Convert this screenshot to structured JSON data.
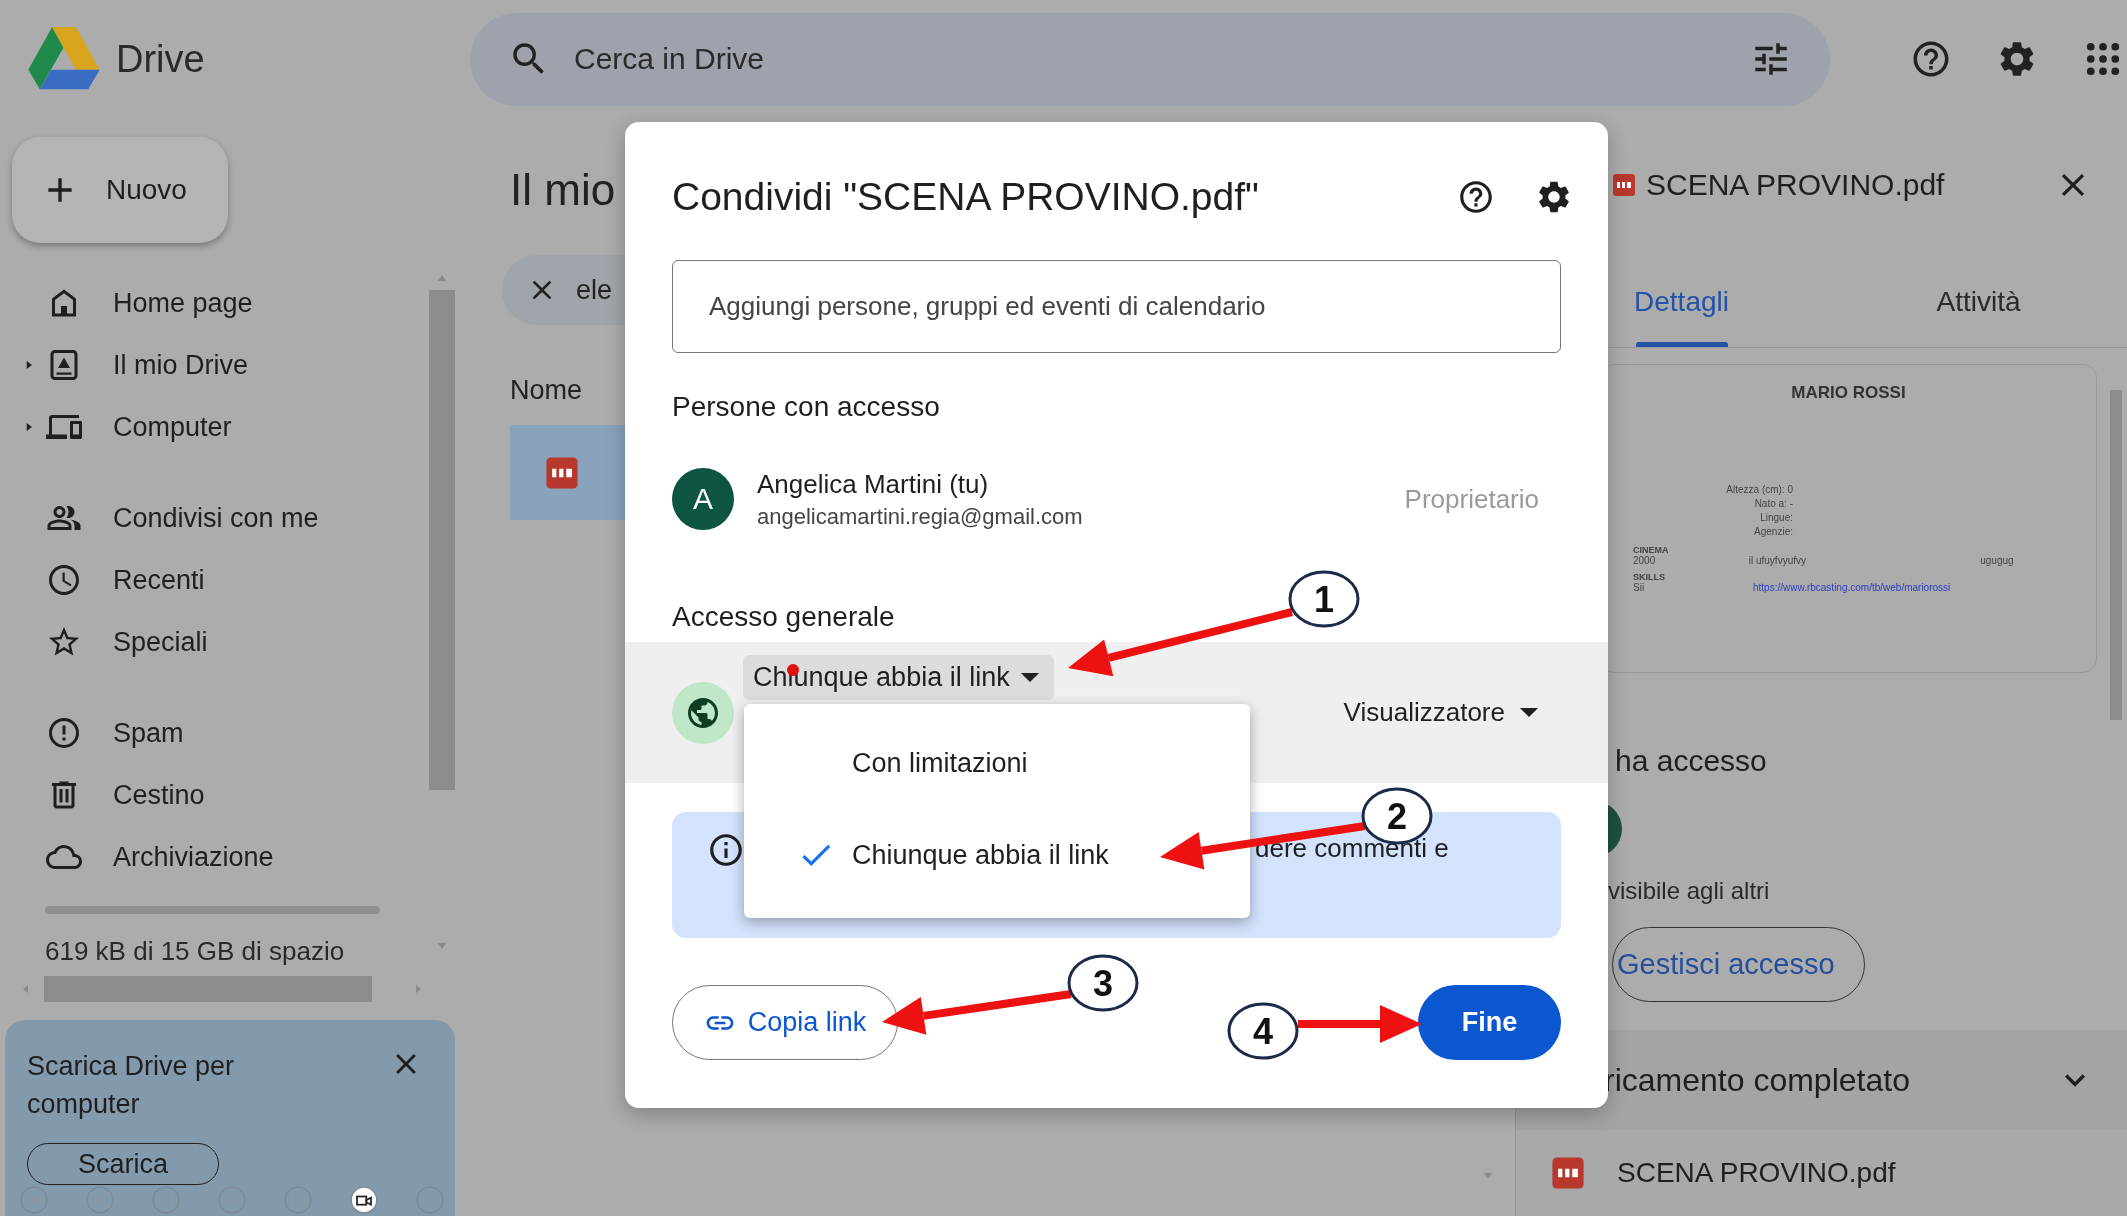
{
  "topbar": {
    "app_name": "Drive",
    "search": {
      "placeholder": "Cerca in Drive"
    }
  },
  "sidebar": {
    "new_button": "Nuovo",
    "sections": [
      [
        {
          "label": "Home page",
          "expandable": false
        },
        {
          "label": "Il mio Drive",
          "expandable": true
        },
        {
          "label": "Computer",
          "expandable": true
        }
      ],
      [
        {
          "label": "Condivisi con me",
          "expandable": false
        },
        {
          "label": "Recenti",
          "expandable": false
        },
        {
          "label": "Speciali",
          "expandable": false
        }
      ],
      [
        {
          "label": "Spam",
          "expandable": false
        },
        {
          "label": "Cestino",
          "expandable": false
        },
        {
          "label": "Archiviazione",
          "expandable": false
        }
      ]
    ],
    "storage_text": "619 kB di 15 GB di spazio",
    "banner": {
      "text": "Scarica Drive per computer",
      "button": "Scarica"
    }
  },
  "main": {
    "title": "Il mio",
    "filter_chip": "ele",
    "column": "Nome",
    "rows": [
      {
        "selected": true
      }
    ]
  },
  "share_dialog": {
    "title": "Condividi \"SCENA PROVINO.pdf\"",
    "field_placeholder": "Aggiungi persone, gruppi ed eventi di calendario",
    "people_heading": "Persone con accesso",
    "people": [
      {
        "initial": "A",
        "name": "Angelica Martini (tu)",
        "email": "angelicamartini.regia@gmail.com",
        "role": "Proprietario"
      }
    ],
    "general_heading": "Accesso generale",
    "access": {
      "option": "Chiunque abbia il link",
      "role": "Visualizzatore"
    },
    "access_menu": [
      {
        "label": "Con limitazioni",
        "selected": false
      },
      {
        "label": "Chiunque abbia il link",
        "selected": true
      }
    ],
    "info_text": "dere commenti e",
    "copy_link_button": "Copia link",
    "done_button": "Fine"
  },
  "details": {
    "file_name": "SCENA PROVINO.pdf",
    "tabs": [
      {
        "label": "Dettagli",
        "selected": true
      },
      {
        "label": "Attività",
        "selected": false
      }
    ],
    "preview": {
      "name": "MARIO ROSSI",
      "fields": [
        "Altezza (cm): 0",
        "Nato a: -",
        "Lingue:",
        "Agenzie:"
      ],
      "sections": [
        {
          "heading": "CINEMA",
          "cells": [
            {
              "text": "2000",
              "kind": "text"
            },
            {
              "text": "il ufuyfvyufvy",
              "kind": "text"
            },
            {
              "text": "ugugug",
              "kind": "text"
            }
          ]
        },
        {
          "heading": "SKILLS",
          "cells": [
            {
              "text": "Sii",
              "kind": "text"
            },
            {
              "text": "https://www.rbcasting.com/tb/web/mariorossi",
              "kind": "link"
            }
          ]
        }
      ]
    },
    "access_heading": "ha accesso",
    "visibility_note": "visibile agli altri",
    "manage_button": "Gestisci accesso"
  },
  "uploads": {
    "title": "ricamento completato",
    "files": [
      {
        "name": "SCENA PROVINO.pdf"
      }
    ]
  },
  "annotations": [
    {
      "number": "1"
    },
    {
      "number": "2"
    },
    {
      "number": "3"
    },
    {
      "number": "4"
    }
  ]
}
